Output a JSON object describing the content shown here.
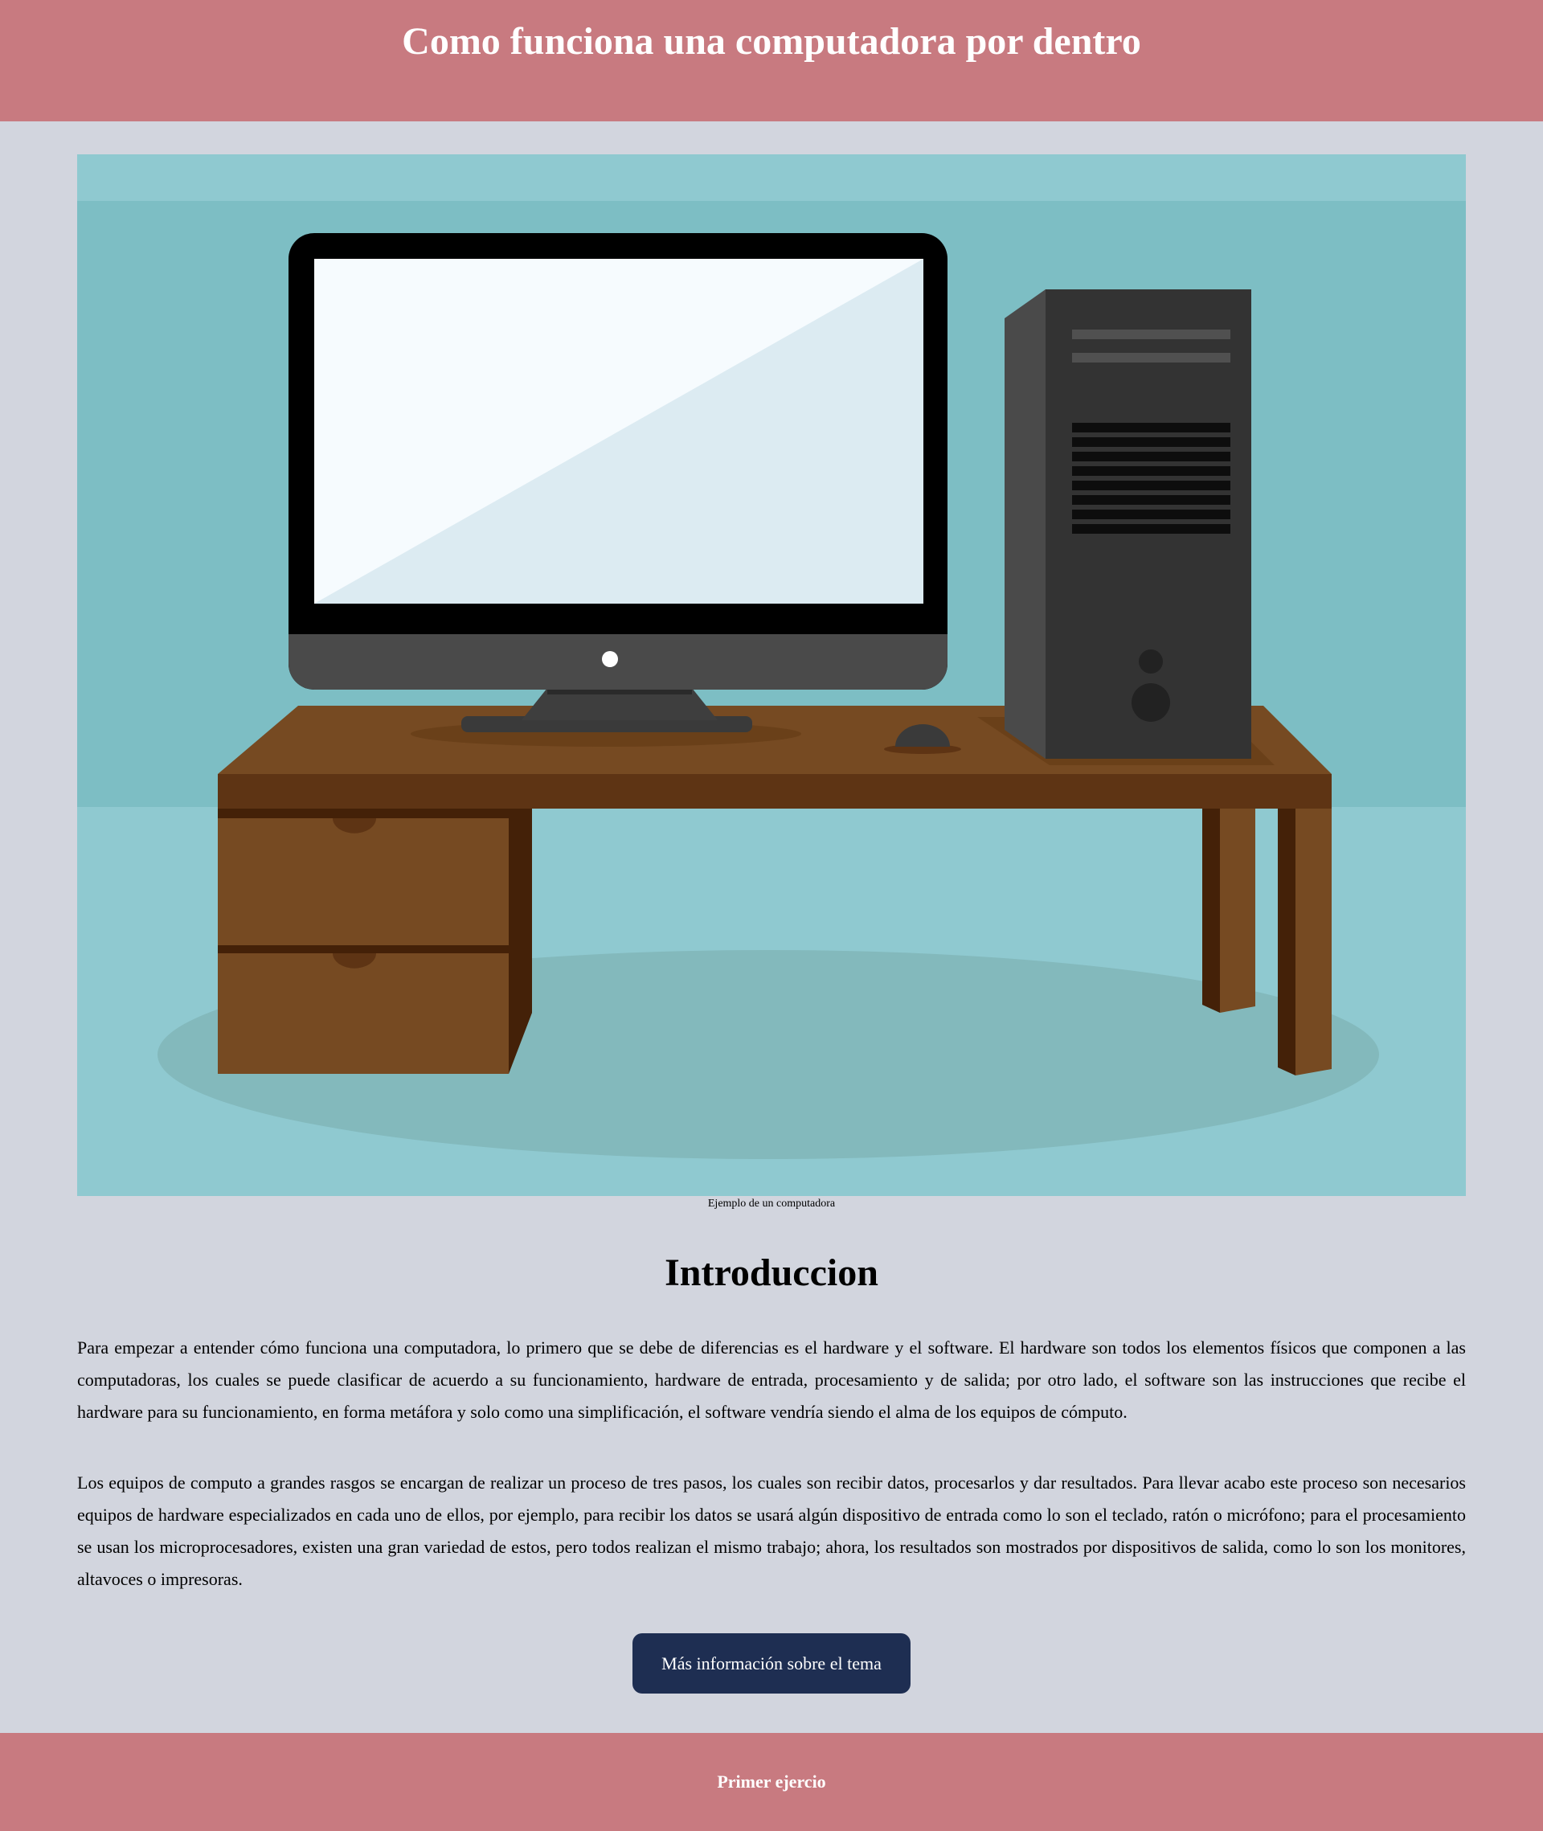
{
  "header": {
    "title": "Como funciona una computadora por dentro"
  },
  "figure": {
    "illustration": "desktop-computer-on-desk",
    "caption": "Ejemplo de un computadora"
  },
  "section": {
    "title": "Introduccion",
    "paragraphs": [
      "Para empezar a entender cómo funciona una computadora, lo primero que se debe de diferencias es el hardware y el software. El hardware son todos los elementos físicos que componen a las computadoras, los cuales se puede clasificar de acuerdo a su funcionamiento, hardware de entrada, procesamiento y de salida; por otro lado, el software son las instrucciones que recibe el hardware para su funcionamiento, en forma metáfora y solo como una simplificación, el software vendría siendo el alma de los equipos de cómputo.",
      "Los equipos de computo a grandes rasgos se encargan de realizar un proceso de tres pasos, los cuales son recibir datos, procesarlos y dar resultados. Para llevar acabo este proceso son necesarios equipos de hardware especializados en cada uno de ellos, por ejemplo, para recibir los datos se usará algún dispositivo de entrada como lo son el teclado, ratón o micrófono; para el procesamiento se usan los microprocesadores, existen una gran variedad de estos, pero todos realizan el mismo trabajo; ahora, los resultados son mostrados por dispositivos de salida, como lo son los monitores, altavoces o impresoras."
    ],
    "button_label": "Más información sobre el tema"
  },
  "footer": {
    "link_label": "Primer ejercio"
  },
  "colors": {
    "header_footer_bg": "#c87a80",
    "page_bg": "#d2d5de",
    "button_bg": "#1e2e52",
    "illustration_bg": "#8fc9d0"
  }
}
